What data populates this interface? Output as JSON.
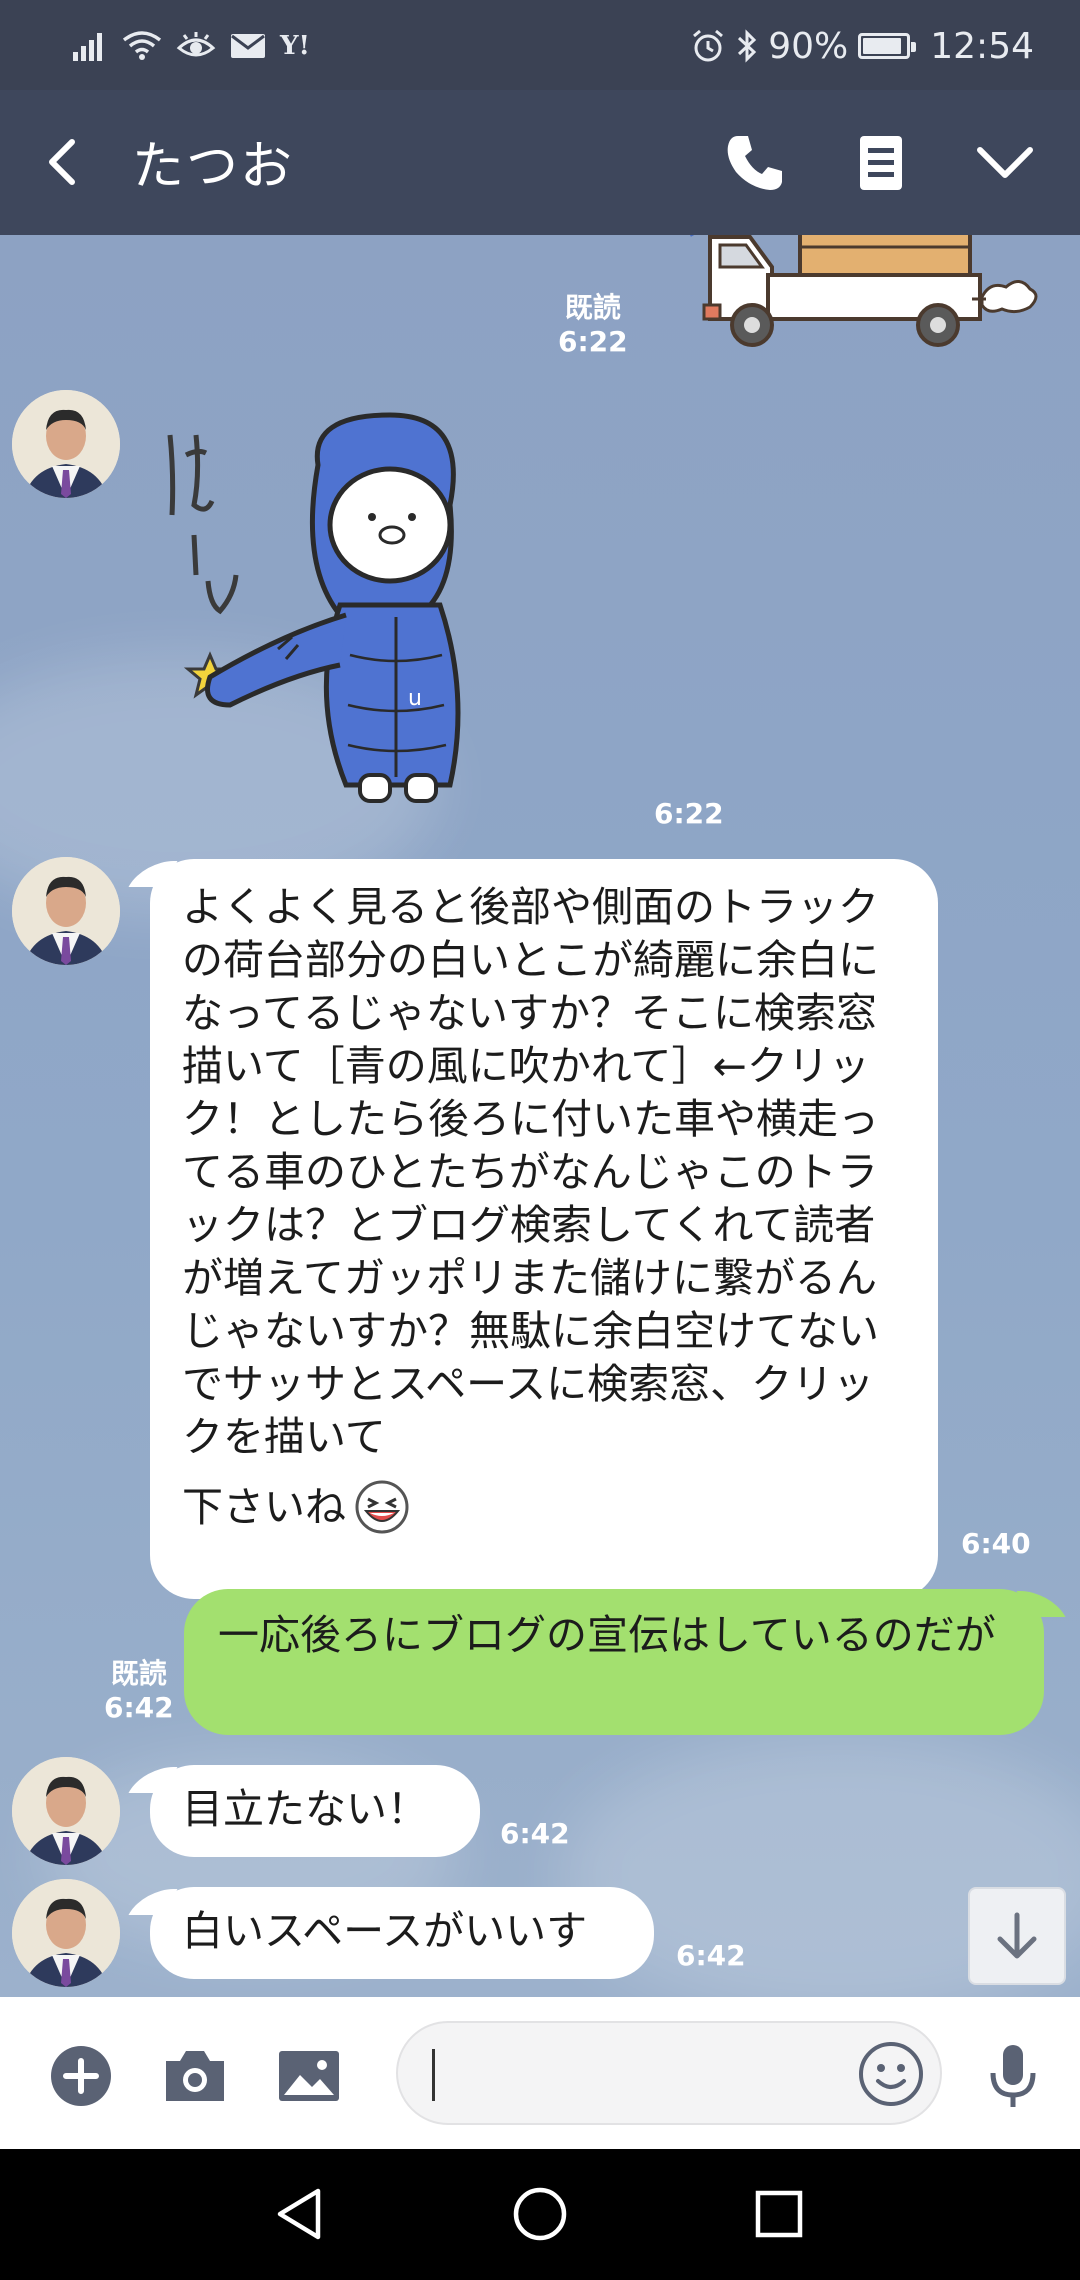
{
  "status_bar": {
    "yahoo_label": "Y!",
    "battery_percent": "90%",
    "battery_level": 0.9,
    "time": "12:54"
  },
  "header": {
    "title": "たつお"
  },
  "messages": {
    "m1": {
      "read": "既読",
      "time": "6:22"
    },
    "m2": {
      "time": "6:22"
    },
    "m3": {
      "text": "よくよく見ると後部や側面のトラックの荷台部分の白いとこが綺麗に余白になってるじゃないすか？そこに検索窓描いて［青の風に吹かれて］←クリック！としたら後ろに付いた車や横走ってる車のひとたちがなんじゃこのトラックは？とブログ検索してくれて読者が増えてガッポリまた儲けに繋がるんじゃないすか？無駄に余白空けてないでサッサとスペースに検索窓、クリックを描いて",
      "text_end": "下さいね",
      "time": "6:40"
    },
    "m4": {
      "text": "一応後ろにブログの宣伝はしているのだが",
      "read": "既読",
      "time": "6:42"
    },
    "m5": {
      "text": "目立たない！",
      "time": "6:42"
    },
    "m6": {
      "text": "白いスペースがいいす",
      "time": "6:42"
    }
  },
  "stickers": {
    "truck": "truck-sticker",
    "bear": "hooded-character-sticker",
    "bear_text": "はーい"
  },
  "input": {
    "placeholder": ""
  },
  "colors": {
    "header_bg": "#3e475c",
    "status_bg": "#3b4254",
    "my_bubble": "#a3e06f",
    "their_bubble": "#ffffff",
    "chat_bg": "#8ea5c6"
  }
}
